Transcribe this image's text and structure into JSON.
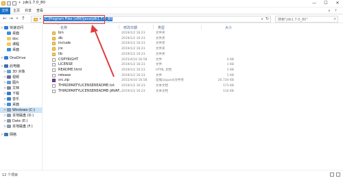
{
  "window": {
    "title": "jdk1.7.0_80",
    "minimize": "—",
    "maximize": "☐",
    "close": "✕"
  },
  "ribbon": {
    "tabs": [
      "文件",
      "主页",
      "共享",
      "查看"
    ],
    "collapse": "∨",
    "help": "?"
  },
  "address": {
    "back": "←",
    "forward": "→",
    "up_history": "∨",
    "up": "↑",
    "separator": "»",
    "path": "C:\\Program Files (x86)\\Java\\jdk1.7.0_80",
    "dropdown": "∨",
    "refresh": "↻",
    "search_placeholder": "搜索\"jdk1.7.0_80\"",
    "search_icon": "⌕"
  },
  "sidebar": {
    "items": [
      {
        "label": "快速访问",
        "icon": "star",
        "expand": ">",
        "indent": 0
      },
      {
        "label": "桌面",
        "icon": "desktop",
        "expand": "",
        "indent": 1
      },
      {
        "label": "doc",
        "icon": "folder",
        "expand": "",
        "indent": 1
      },
      {
        "label": "课程",
        "icon": "folder",
        "expand": "",
        "indent": 1
      },
      {
        "label": "桌面",
        "icon": "desktop",
        "expand": "",
        "indent": 1
      },
      {
        "label": "OneDrive",
        "icon": "cloud",
        "expand": ">",
        "indent": 0
      },
      {
        "label": "此电脑",
        "icon": "pc",
        "expand": ">",
        "indent": 0
      },
      {
        "label": "3D 对象",
        "icon": "cube",
        "expand": ">",
        "indent": 1
      },
      {
        "label": "视频",
        "icon": "video",
        "expand": ">",
        "indent": 1
      },
      {
        "label": "图片",
        "icon": "picture",
        "expand": ">",
        "indent": 1
      },
      {
        "label": "文档",
        "icon": "document",
        "expand": ">",
        "indent": 1
      },
      {
        "label": "下载",
        "icon": "download",
        "expand": ">",
        "indent": 1
      },
      {
        "label": "音乐",
        "icon": "music",
        "expand": ">",
        "indent": 1
      },
      {
        "label": "桌面",
        "icon": "desktop",
        "expand": ">",
        "indent": 1
      },
      {
        "label": "Windows (C:)",
        "icon": "drive",
        "expand": ">",
        "indent": 1,
        "selected": true
      },
      {
        "label": "本地磁盘 (D:)",
        "icon": "drive",
        "expand": ">",
        "indent": 1
      },
      {
        "label": "Date (E:)",
        "icon": "drive",
        "expand": ">",
        "indent": 1
      },
      {
        "label": "本地磁盘 (F:)",
        "icon": "drive",
        "expand": ">",
        "indent": 1
      },
      {
        "label": "网络",
        "icon": "network",
        "expand": ">",
        "indent": 0
      }
    ]
  },
  "columns": {
    "name": "名称",
    "date": "修改日期",
    "type": "类型",
    "size": "大小",
    "sort_indicator": "^"
  },
  "files": [
    {
      "name": "bin",
      "date": "2019/1/2 16:23",
      "type": "文件夹",
      "size": "",
      "kind": "folder"
    },
    {
      "name": "db",
      "date": "2019/1/2 16:23",
      "type": "文件夹",
      "size": "",
      "kind": "folder"
    },
    {
      "name": "include",
      "date": "2019/1/2 16:23",
      "type": "文件夹",
      "size": "",
      "kind": "folder"
    },
    {
      "name": "jre",
      "date": "2019/1/2 16:23",
      "type": "文件夹",
      "size": "",
      "kind": "folder"
    },
    {
      "name": "lib",
      "date": "2019/1/2 16:23",
      "type": "文件夹",
      "size": "",
      "kind": "folder"
    },
    {
      "name": "COPYRIGHT",
      "date": "2015/4/10 16:58",
      "type": "文件",
      "size": "4 KB",
      "kind": "file"
    },
    {
      "name": "LICENSE",
      "date": "2019/1/2 16:23",
      "type": "文件",
      "size": "1 KB",
      "kind": "file"
    },
    {
      "name": "README.html",
      "date": "2019/1/2 16:23",
      "type": "HTML 文档",
      "size": "1 KB",
      "kind": "file"
    },
    {
      "name": "release",
      "date": "2019/1/2 16:23",
      "type": "文件",
      "size": "1 KB",
      "kind": "file"
    },
    {
      "name": "src.zip",
      "date": "2015/4/10 16:58",
      "type": "压缩(zipped)文件夹",
      "size": "20,734 KB",
      "kind": "zip"
    },
    {
      "name": "THIRDPARTYLICENSEREADME.txt",
      "date": "2019/1/2 16:23",
      "type": "文本文档",
      "size": "173 KB",
      "kind": "file"
    },
    {
      "name": "THIRDPARTYLICENSEREADME-JAVAF...",
      "date": "2019/1/2 16:23",
      "type": "文本文档",
      "size": "110 KB",
      "kind": "file"
    }
  ],
  "status": {
    "count": "12 个项目"
  },
  "annotation": {
    "color": "#e03a3a"
  }
}
